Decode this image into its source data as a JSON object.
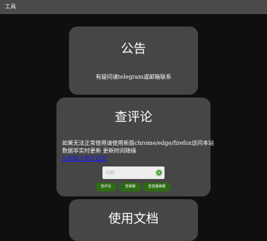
{
  "topbar": {
    "title": "工具"
  },
  "notice": {
    "title": "公告",
    "text": "有疑问请telegram或邮箱联系"
  },
  "review": {
    "title": "查评论",
    "line1": "如果无法正常使用请使用新版chrome/edge/firefox访问本站",
    "line2": "数据非实时更新 更新时间随缘",
    "link_text": "没有输入框点这里",
    "uid_placeholder": "UID",
    "buttons": {
      "review": "查评论",
      "danmaku": "查弹幕",
      "danmaku_live": "查直播弹幕"
    }
  },
  "docs": {
    "title": "使用文档"
  },
  "colors": {
    "background": "#0f0f0f",
    "card": "#464646",
    "button": "#2d6b14",
    "link": "#1a1aff",
    "icon": "#3fa02a"
  }
}
